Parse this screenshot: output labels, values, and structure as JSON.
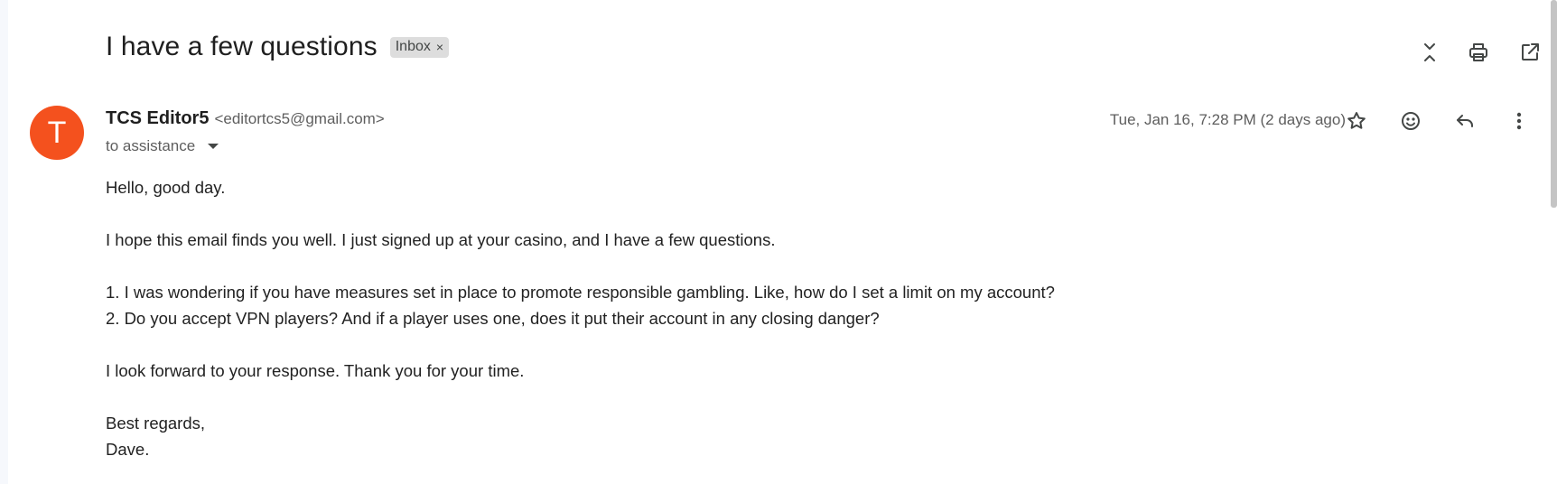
{
  "subject": "I have a few questions",
  "label": {
    "name": "Inbox",
    "remove": "×"
  },
  "sender": {
    "initial": "T",
    "name": "TCS Editor5",
    "email": "<editortcs5@gmail.com>",
    "to": "to assistance",
    "date": "Tue, Jan 16, 7:28 PM (2 days ago)"
  },
  "body": {
    "greeting": "Hello, good day.",
    "intro": "I hope this email finds you well. I just signed up at your casino, and I have a few questions.",
    "q1": "1. I was wondering if you have measures set in place to promote responsible gambling. Like, how do I set a limit on my account?",
    "q2": "2. Do you accept VPN players? And if a player uses one, does it put their account in any closing danger?",
    "closing": "I look forward to your response. Thank you for your time.",
    "signoff": "Best regards,",
    "name": "Dave."
  },
  "icons": {
    "collapse": "collapse-all-icon",
    "print": "print-icon",
    "open_new_window": "open-in-new-window-icon",
    "star": "star-icon",
    "emoji": "emoji-reaction-icon",
    "reply": "reply-icon",
    "more": "more-vertical-icon"
  },
  "colors": {
    "avatar": "#f4511e",
    "chip": "#dddddd"
  }
}
